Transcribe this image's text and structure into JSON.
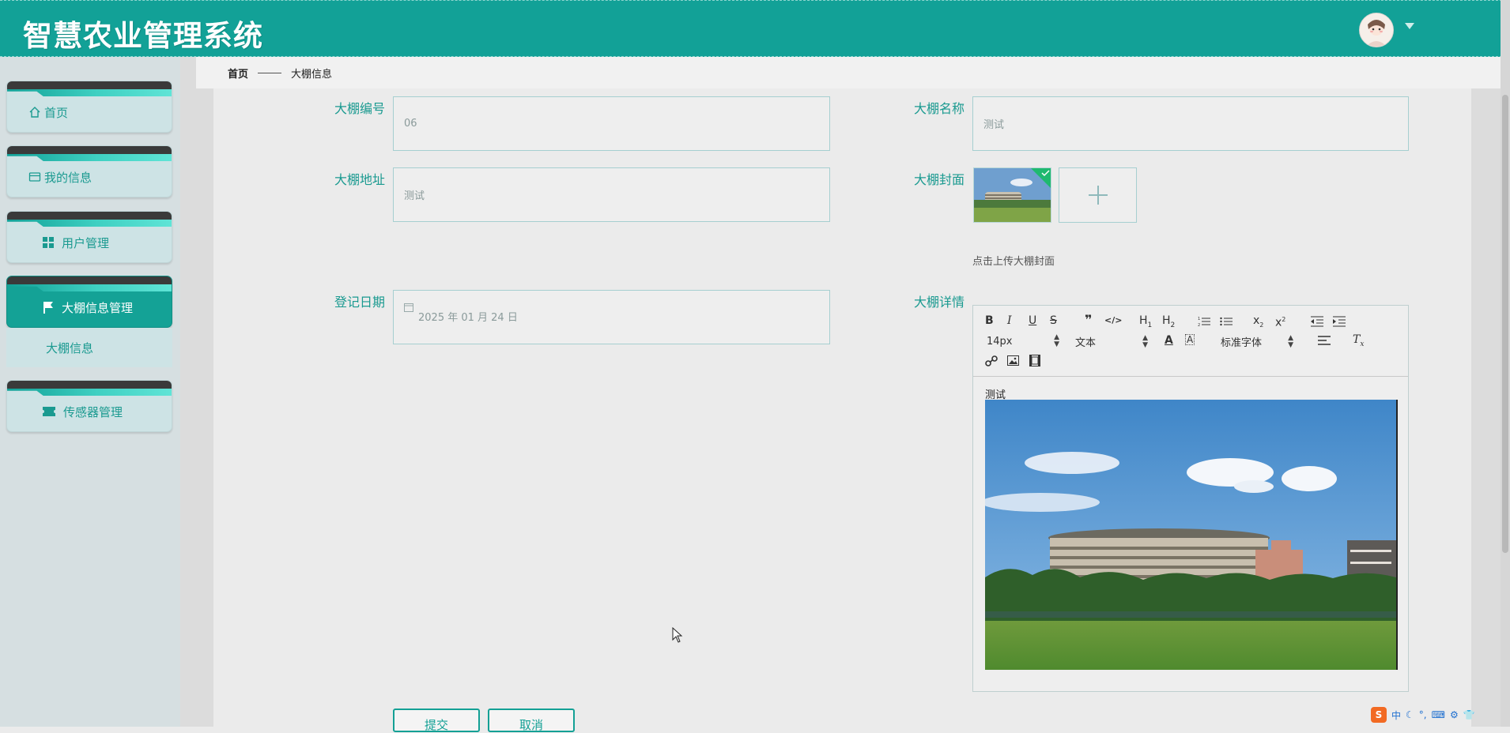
{
  "header": {
    "title": "智慧农业管理系统"
  },
  "sidebar": {
    "items": [
      {
        "label": "首页",
        "icon": "home-icon"
      },
      {
        "label": "我的信息",
        "icon": "id-card-icon"
      },
      {
        "label": "用户管理",
        "icon": "grid-icon"
      },
      {
        "label": "大棚信息管理",
        "icon": "flag-icon",
        "active": true
      },
      {
        "label": "传感器管理",
        "icon": "ticket-icon"
      }
    ],
    "submenu": {
      "label": "大棚信息"
    }
  },
  "breadcrumb": {
    "home": "首页",
    "current": "大棚信息"
  },
  "form": {
    "number": {
      "label": "大棚编号",
      "value": "06"
    },
    "name": {
      "label": "大棚名称",
      "value": "测试"
    },
    "address": {
      "label": "大棚地址",
      "value": "测试"
    },
    "cover": {
      "label": "大棚封面",
      "hint": "点击上传大棚封面"
    },
    "date": {
      "label": "登记日期",
      "value": "2025 年 01 月 24 日"
    },
    "detail": {
      "label": "大棚详情",
      "content_text": "测试"
    }
  },
  "editor": {
    "toolbar_row1": [
      "B",
      "I",
      "U",
      "S",
      "quote",
      "code",
      "H1",
      "H2",
      "ordered-list",
      "bullet-list",
      "subscript",
      "superscript",
      "outdent",
      "indent"
    ],
    "font_size": "14px",
    "header_select": "文本",
    "font_family": "标准字体"
  },
  "buttons": {
    "submit": "提交",
    "cancel": "取消"
  },
  "tray": {
    "ime_lang": "中"
  },
  "colors": {
    "primary": "#12a197",
    "accent_text": "#1a9a90",
    "background": "#ebebeb"
  }
}
